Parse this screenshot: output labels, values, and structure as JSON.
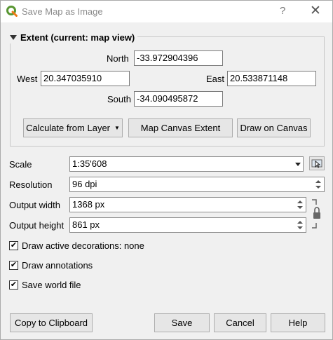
{
  "window": {
    "title": "Save Map as Image",
    "help_glyph": "?",
    "close_glyph": "✕"
  },
  "extent": {
    "title": "Extent (current: map view)",
    "north_label": "North",
    "north_value": "-33.972904396",
    "west_label": "West",
    "west_value": "20.347035910",
    "east_label": "East",
    "east_value": "20.533871148",
    "south_label": "South",
    "south_value": "-34.090495872",
    "calc_from_layer_label": "Calculate from Layer",
    "map_canvas_extent_label": "Map Canvas Extent",
    "draw_on_canvas_label": "Draw on Canvas"
  },
  "settings": {
    "scale_label": "Scale",
    "scale_value": "1:35'608",
    "resolution_label": "Resolution",
    "resolution_value": "96 dpi",
    "output_width_label": "Output width",
    "output_width_value": "1368 px",
    "output_height_label": "Output height",
    "output_height_value": "861 px"
  },
  "options": {
    "draw_decorations_label": "Draw active decorations: none",
    "draw_decorations_checked": true,
    "draw_annotations_label": "Draw annotations",
    "draw_annotations_checked": true,
    "save_world_file_label": "Save world file",
    "save_world_file_checked": true,
    "check_glyph": "✔"
  },
  "footer": {
    "copy_label": "Copy to Clipboard",
    "save_label": "Save",
    "cancel_label": "Cancel",
    "help_label": "Help"
  },
  "colors": {
    "accent_green": "#589632",
    "accent_yellow": "#ee7913"
  },
  "icons": {
    "app": "qgis-logo-icon",
    "map_pick": "map-tool-icon",
    "lock": "padlock-icon"
  }
}
